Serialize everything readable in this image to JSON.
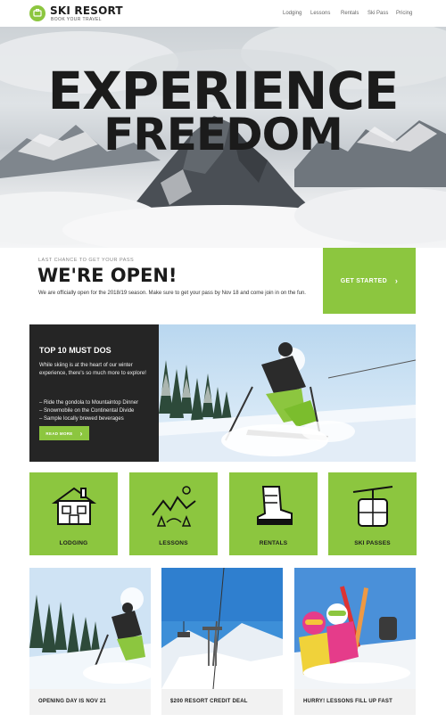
{
  "brand": {
    "name": "SKI RESORT",
    "tagline": "BOOK YOUR TRAVEL",
    "accent_color": "#8cc63f",
    "dark_color": "#252525"
  },
  "nav": {
    "items": [
      "Lodging",
      "Lessons",
      "Rentals",
      "Ski Pass",
      "Pricing"
    ]
  },
  "hero": {
    "line1": "EXPERIENCE",
    "line2": "FREEDOM"
  },
  "open_banner": {
    "eyebrow": "LAST CHANCE TO GET YOUR PASS",
    "title": "WE'RE OPEN!",
    "text": "We are officially open for the 2018/19 season. Make sure to get your pass by Nov 18 and come join in on the fun.",
    "cta_label": "GET STARTED",
    "cta_icon": "chevron-right-icon"
  },
  "top10": {
    "title": "TOP 10 MUST DOS",
    "text": "While skiing is at the heart of our winter experience, there's so much more to explore!",
    "list": [
      "– Ride the gondola to Mountaintop Dinner",
      "– Snowmobile on the Continental Divide",
      "– Sample locally brewed beverages"
    ],
    "button_label": "READ MORE"
  },
  "tiles": [
    {
      "label": "LODGING",
      "icon": "cabin-icon"
    },
    {
      "label": "LESSONS",
      "icon": "mountains-icon"
    },
    {
      "label": "RENTALS",
      "icon": "ski-boot-icon"
    },
    {
      "label": "SKI PASSES",
      "icon": "gondola-icon"
    }
  ],
  "cards": [
    {
      "caption": "OPENING DAY IS NOV 21"
    },
    {
      "caption": "$200 RESORT CREDIT DEAL"
    },
    {
      "caption": "HURRY! LESSONS FILL UP FAST"
    }
  ]
}
